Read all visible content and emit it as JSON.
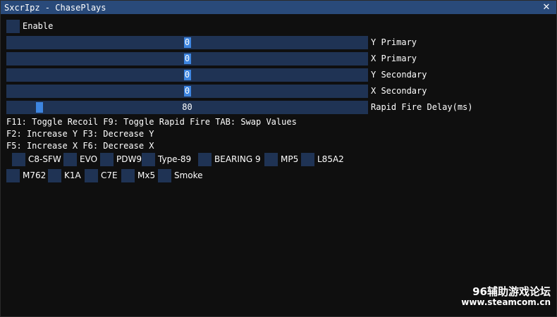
{
  "window": {
    "title": "SxcrIpz - ChasePlays",
    "close_glyph": "✕",
    "titlebar_color": "#294a7a",
    "background": "#0f0f0f"
  },
  "enable": {
    "label": "Enable",
    "checked": false
  },
  "sliders": [
    {
      "label": "Y Primary",
      "value": "0",
      "fraction": 0.5
    },
    {
      "label": "X Primary",
      "value": "0",
      "fraction": 0.5
    },
    {
      "label": "Y Secondary",
      "value": "0",
      "fraction": 0.5
    },
    {
      "label": "X Secondary",
      "value": "0",
      "fraction": 0.5
    },
    {
      "label": "Rapid Fire Delay(ms)",
      "value": "80",
      "fraction": 0.08
    }
  ],
  "help": [
    "F11: Toggle Recoil  F9: Toggle Rapid Fire  TAB: Swap Values",
    "F2: Increase Y   F3: Decrease Y",
    "F5: Increase X   F6: Decrease X"
  ],
  "weapons_row1": [
    "C8-SFW",
    "EVO",
    "PDW9",
    "Type-89",
    "BEARING 9",
    "MP5",
    "L85A2"
  ],
  "weapons_row2": [
    "M762",
    "K1A",
    "C7E",
    "Mx5",
    "Smoke"
  ],
  "watermark": {
    "line1": "96辅助游戏论坛",
    "line2": "www.steamcom.cn"
  },
  "colors": {
    "frame": "#1f3354",
    "slider_grab": "#3d85e0"
  }
}
